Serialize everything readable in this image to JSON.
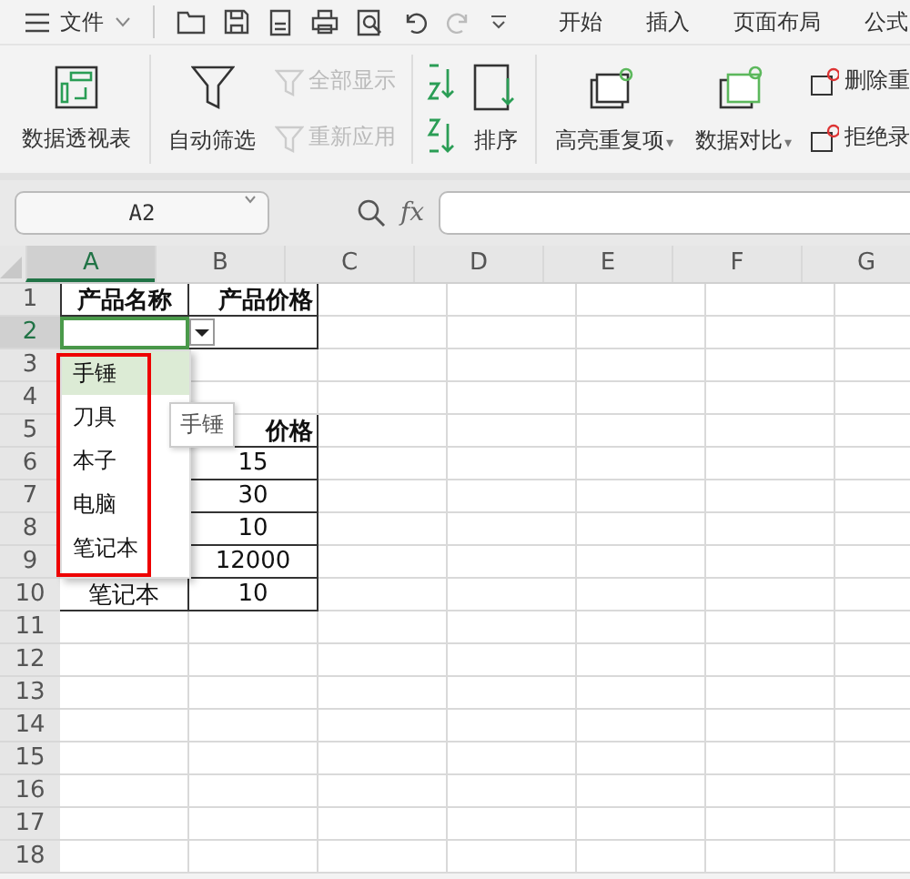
{
  "menu": {
    "file_label": "文件",
    "tabs": [
      {
        "label": "开始"
      },
      {
        "label": "插入"
      },
      {
        "label": "页面布局"
      },
      {
        "label": "公式"
      }
    ]
  },
  "ribbon": [
    {
      "kind": "big",
      "label": "数据透视表"
    },
    {
      "kind": "big",
      "label": "自动筛选"
    },
    {
      "kind": "pair",
      "items": [
        {
          "label": "全部显示",
          "disabled": true
        },
        {
          "label": "重新应用",
          "disabled": true
        }
      ]
    },
    {
      "kind": "sort",
      "label": "排序"
    },
    {
      "kind": "big",
      "label": "高亮重复项",
      "caret": "▾"
    },
    {
      "kind": "big",
      "label": "数据对比",
      "caret": "▾"
    },
    {
      "kind": "pair",
      "items": [
        {
          "label": "删除重",
          "disabled": false
        },
        {
          "label": "拒绝录",
          "disabled": false
        }
      ]
    }
  ],
  "formula_bar": {
    "name_box": "A2",
    "fx": "fx"
  },
  "sheet": {
    "columns": [
      {
        "label": "A",
        "selected": true
      },
      {
        "label": "B",
        "selected": false
      },
      {
        "label": "C",
        "selected": false
      },
      {
        "label": "D",
        "selected": false
      },
      {
        "label": "E",
        "selected": false
      },
      {
        "label": "F",
        "selected": false
      },
      {
        "label": "G",
        "selected": false
      }
    ],
    "rows": [
      {
        "label": "1",
        "selected": false,
        "bordered": true,
        "a": "产品名称",
        "b": "产品价格",
        "bold": true
      },
      {
        "label": "2",
        "selected": true,
        "bordered": true,
        "active": true
      },
      {
        "label": "3",
        "selected": false,
        "bordered": false
      },
      {
        "label": "4",
        "selected": false,
        "bordered": false
      },
      {
        "label": "5",
        "selected": false,
        "bordered": true,
        "b": "价格",
        "bold": true
      },
      {
        "label": "6",
        "selected": false,
        "bordered": true,
        "b": "15"
      },
      {
        "label": "7",
        "selected": false,
        "bordered": true,
        "b": "30"
      },
      {
        "label": "8",
        "selected": false,
        "bordered": true,
        "b": "10"
      },
      {
        "label": "9",
        "selected": false,
        "bordered": true,
        "b": "12000"
      },
      {
        "label": "10",
        "selected": false,
        "bordered": true,
        "a": "笔记本",
        "b": "10"
      },
      {
        "label": "11",
        "selected": false,
        "bordered": false
      },
      {
        "label": "12",
        "selected": false,
        "bordered": false
      },
      {
        "label": "13",
        "selected": false,
        "bordered": false
      },
      {
        "label": "14",
        "selected": false,
        "bordered": false
      },
      {
        "label": "15",
        "selected": false,
        "bordered": false
      },
      {
        "label": "16",
        "selected": false,
        "bordered": false
      },
      {
        "label": "17",
        "selected": false,
        "bordered": false
      },
      {
        "label": "18",
        "selected": false,
        "bordered": false
      }
    ],
    "dropdown": {
      "items": [
        {
          "label": "手锤",
          "selected": true
        },
        {
          "label": "刀具",
          "selected": false
        },
        {
          "label": "本子",
          "selected": false
        },
        {
          "label": "电脑",
          "selected": false
        },
        {
          "label": "笔记本",
          "selected": false
        }
      ]
    },
    "tooltip": "手锤"
  }
}
